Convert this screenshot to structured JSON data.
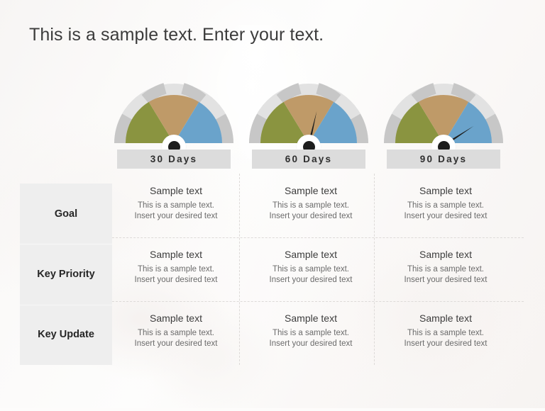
{
  "title": "This is a sample text. Enter your text.",
  "theme": {
    "arc_olive": "#8a9440",
    "arc_tan": "#bf9a68",
    "arc_blue": "#6aa3cb",
    "ring_light": "#e2e2e2",
    "ring_tick": "#c7c7c7",
    "bar_bg": "#dcdcdc",
    "label_bg": "#eeeeee",
    "needle": "#1d1d1d",
    "title_color": "#3c3c3c",
    "background": "#fdfcfb"
  },
  "gauges": [
    {
      "label": "30 Days",
      "needle_angle_deg": 200,
      "value_zone": "olive"
    },
    {
      "label": "60 Days",
      "needle_angle_deg": 77,
      "value_zone": "tan"
    },
    {
      "label": "90 Days",
      "needle_angle_deg": 33,
      "value_zone": "blue"
    }
  ],
  "row_labels": [
    {
      "label": "Goal"
    },
    {
      "label": "Key Priority"
    },
    {
      "label": "Key Update"
    }
  ],
  "cells": [
    {
      "heading": "Sample text",
      "line1": "This is a sample text.",
      "line2": "Insert your desired text"
    },
    {
      "heading": "Sample text",
      "line1": "This is a sample text.",
      "line2": "Insert your desired text"
    },
    {
      "heading": "Sample text",
      "line1": "This is a sample text.",
      "line2": "Insert your desired text"
    },
    {
      "heading": "Sample text",
      "line1": "This is a sample text.",
      "line2": "Insert your desired text"
    },
    {
      "heading": "Sample text",
      "line1": "This is a sample text.",
      "line2": "Insert your desired text"
    },
    {
      "heading": "Sample text",
      "line1": "This is a sample text.",
      "line2": "Insert your desired text"
    },
    {
      "heading": "Sample text",
      "line1": "This is a sample text.",
      "line2": "Insert your desired text"
    },
    {
      "heading": "Sample text",
      "line1": "This is a sample text.",
      "line2": "Insert your desired text"
    },
    {
      "heading": "Sample text",
      "line1": "This is a sample text.",
      "line2": "Insert your desired text"
    }
  ]
}
